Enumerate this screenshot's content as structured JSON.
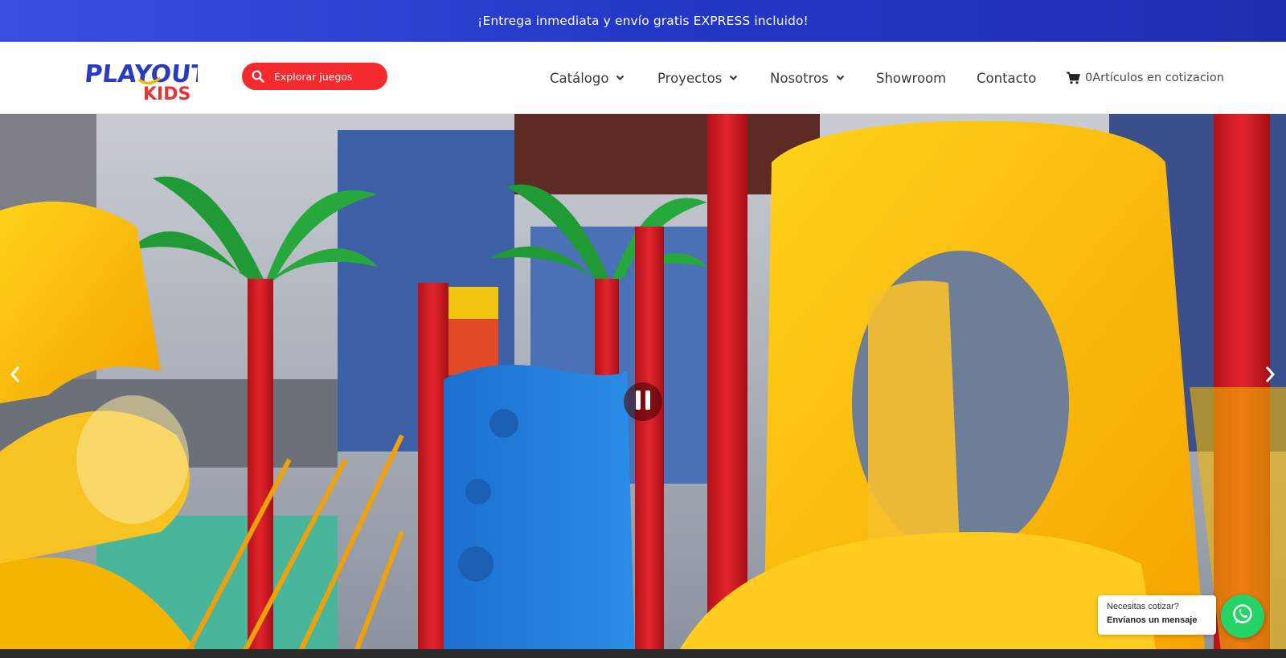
{
  "announcement": {
    "text": "¡Entrega inmediata y envío gratis EXPRESS incluido!"
  },
  "logo": {
    "line1": "PLAYOUT",
    "line2": "KIDS"
  },
  "search": {
    "placeholder": "Explorar juegos",
    "icon": "search-icon"
  },
  "nav": {
    "items": [
      {
        "label": "Catálogo",
        "has_dropdown": true
      },
      {
        "label": "Proyectos",
        "has_dropdown": true
      },
      {
        "label": "Nosotros",
        "has_dropdown": true
      },
      {
        "label": "Showroom",
        "has_dropdown": false
      },
      {
        "label": "Contacto",
        "has_dropdown": false
      }
    ],
    "cart": {
      "count": "0",
      "label": "Artículos en cotizacion",
      "icon": "cart-icon"
    }
  },
  "hero": {
    "controls": {
      "prev_icon": "chevron-left-icon",
      "next_icon": "chevron-right-icon",
      "pause_icon": "pause-icon"
    }
  },
  "whatsapp": {
    "question": "Necesitas cotizar?",
    "action": "Envíanos un mensaje",
    "icon": "whatsapp-icon"
  },
  "colors": {
    "announcement_bg": "#2438c8",
    "search_bg": "#f52a2f",
    "brand_blue": "#2b3bbd",
    "brand_red": "#e8333a",
    "brand_yellow": "#f5b70a",
    "whatsapp_green": "#25d366"
  }
}
